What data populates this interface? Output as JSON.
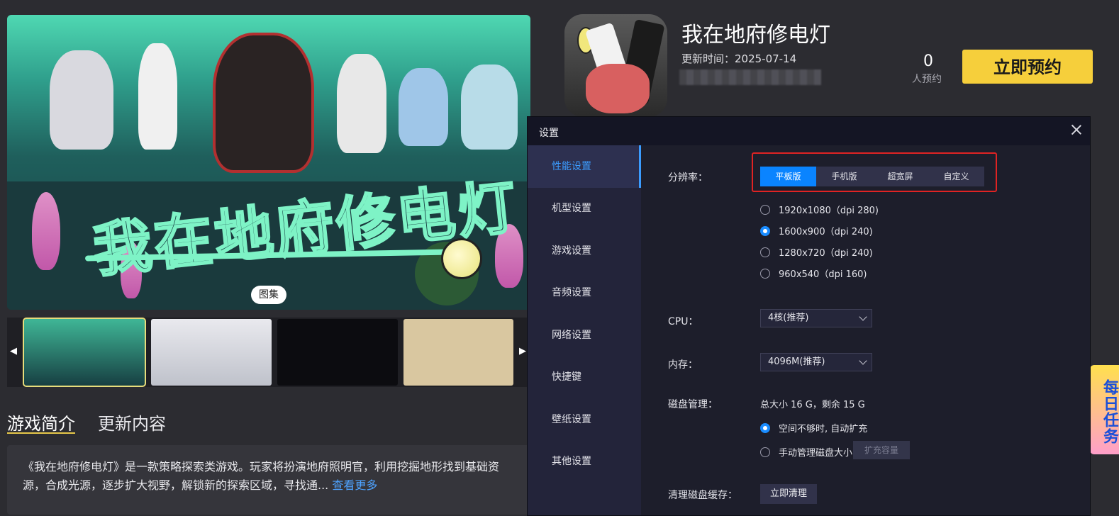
{
  "hero": {
    "gallery_label": "图集"
  },
  "info_tabs": [
    "游戏简介",
    "更新内容"
  ],
  "description": {
    "text": "《我在地府修电灯》是一款策略探索类游戏。玩家将扮演地府照明官，利用挖掘地形找到基础资源，合成光源，逐步扩大视野，解锁新的探索区域，寻找通...",
    "more_link": "查看更多"
  },
  "app": {
    "title": "我在地府修电灯",
    "update_time": "更新时间：2025-07-14",
    "reserve_count": "0",
    "reserve_label": "人预约",
    "reserve_button": "立即预约"
  },
  "daily_task": "每日任务",
  "dialog": {
    "title": "设置",
    "nav": [
      "性能设置",
      "机型设置",
      "游戏设置",
      "音频设置",
      "网络设置",
      "快捷键",
      "壁纸设置",
      "其他设置"
    ],
    "active_nav": "性能设置",
    "resolution": {
      "label": "分辨率：",
      "modes": [
        "平板版",
        "手机版",
        "超宽屏",
        "自定义"
      ],
      "active_mode": "平板版",
      "options": [
        "1920x1080（dpi 280)",
        "1600x900（dpi 240)",
        "1280x720（dpi 240)",
        "960x540（dpi 160)"
      ],
      "selected": "1600x900（dpi 240)"
    },
    "cpu": {
      "label": "CPU：",
      "value": "4核(推荐)"
    },
    "memory": {
      "label": "内存：",
      "value": "4096M(推荐)"
    },
    "disk": {
      "label": "磁盘管理：",
      "info": "总大小 16 G，剩余 15 G",
      "options": [
        "空间不够时, 自动扩充",
        "手动管理磁盘大小"
      ],
      "selected": "空间不够时, 自动扩充",
      "expand_button": "扩充容量"
    },
    "cache": {
      "label": "清理磁盘缓存：",
      "button": "立即清理"
    }
  },
  "colors": {
    "accent": "#0a84ff",
    "reserve": "#f6cf3b",
    "highlight_box": "#e02323"
  }
}
